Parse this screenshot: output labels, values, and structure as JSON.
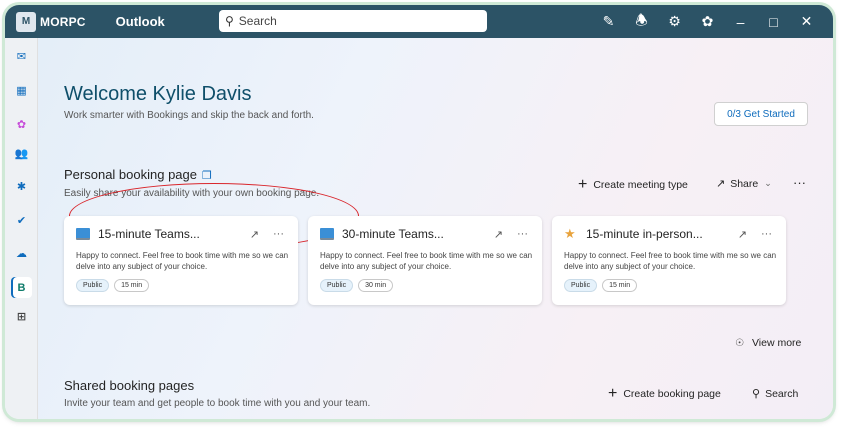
{
  "titlebar": {
    "org_logo_text": "M",
    "org_name": "MORPC",
    "app_name": "Outlook",
    "search_placeholder": "Search",
    "icons": [
      "compose-icon",
      "bell-icon",
      "settings-icon",
      "copilot-icon",
      "minimize-icon",
      "maximize-icon",
      "close-icon"
    ]
  },
  "rail": {
    "items": [
      {
        "name": "mail",
        "glyph": "✉",
        "color": "#0f6cbd"
      },
      {
        "name": "calendar",
        "glyph": "▦",
        "color": "#0f6cbd"
      },
      {
        "name": "copilot",
        "glyph": "✿",
        "color": "#c64bd8"
      },
      {
        "name": "people",
        "glyph": "👥",
        "color": "#0f6cbd"
      },
      {
        "name": "groups",
        "glyph": "✱",
        "color": "#0f6cbd"
      },
      {
        "name": "todo",
        "glyph": "✔",
        "color": "#0f6cbd"
      },
      {
        "name": "onedrive",
        "glyph": "☁",
        "color": "#0f6cbd"
      },
      {
        "name": "bookings",
        "glyph": "B",
        "color": "#107c6b"
      },
      {
        "name": "apps",
        "glyph": "⊞",
        "color": "#444444"
      }
    ]
  },
  "welcome": {
    "title": "Welcome Kylie Davis",
    "subtitle": "Work smarter with Bookings and skip the back and forth.",
    "get_started": "0/3  Get Started"
  },
  "personal": {
    "title": "Personal booking page",
    "subtitle": "Easily share your availability with your own booking page.",
    "create_label": "Create meeting type",
    "share_label": "Share",
    "more_label": "···"
  },
  "cards": [
    {
      "title": "15-minute Teams...",
      "icon": "laptop",
      "desc": "Happy to connect. Feel free to book time with me so we can delve into any subject of your choice.",
      "visibility": "Public",
      "duration": "15 min"
    },
    {
      "title": "30-minute Teams...",
      "icon": "laptop",
      "desc": "Happy to connect. Feel free to book time with me so we can delve into any subject of your choice.",
      "visibility": "Public",
      "duration": "30 min"
    },
    {
      "title": "15-minute in-person...",
      "icon": "person",
      "desc": "Happy to connect. Feel free to book time with me so we can delve into any subject of your choice.",
      "visibility": "Public",
      "duration": "15 min"
    }
  ],
  "view_more": "View more",
  "shared": {
    "title": "Shared booking pages",
    "subtitle": "Invite your team and get people to book time with you and your team.",
    "create_label": "Create booking page",
    "search_label": "Search"
  },
  "colors": {
    "titlebar": "#2c5366",
    "accent": "#0f6cbd",
    "annotation": "#d9262c"
  }
}
